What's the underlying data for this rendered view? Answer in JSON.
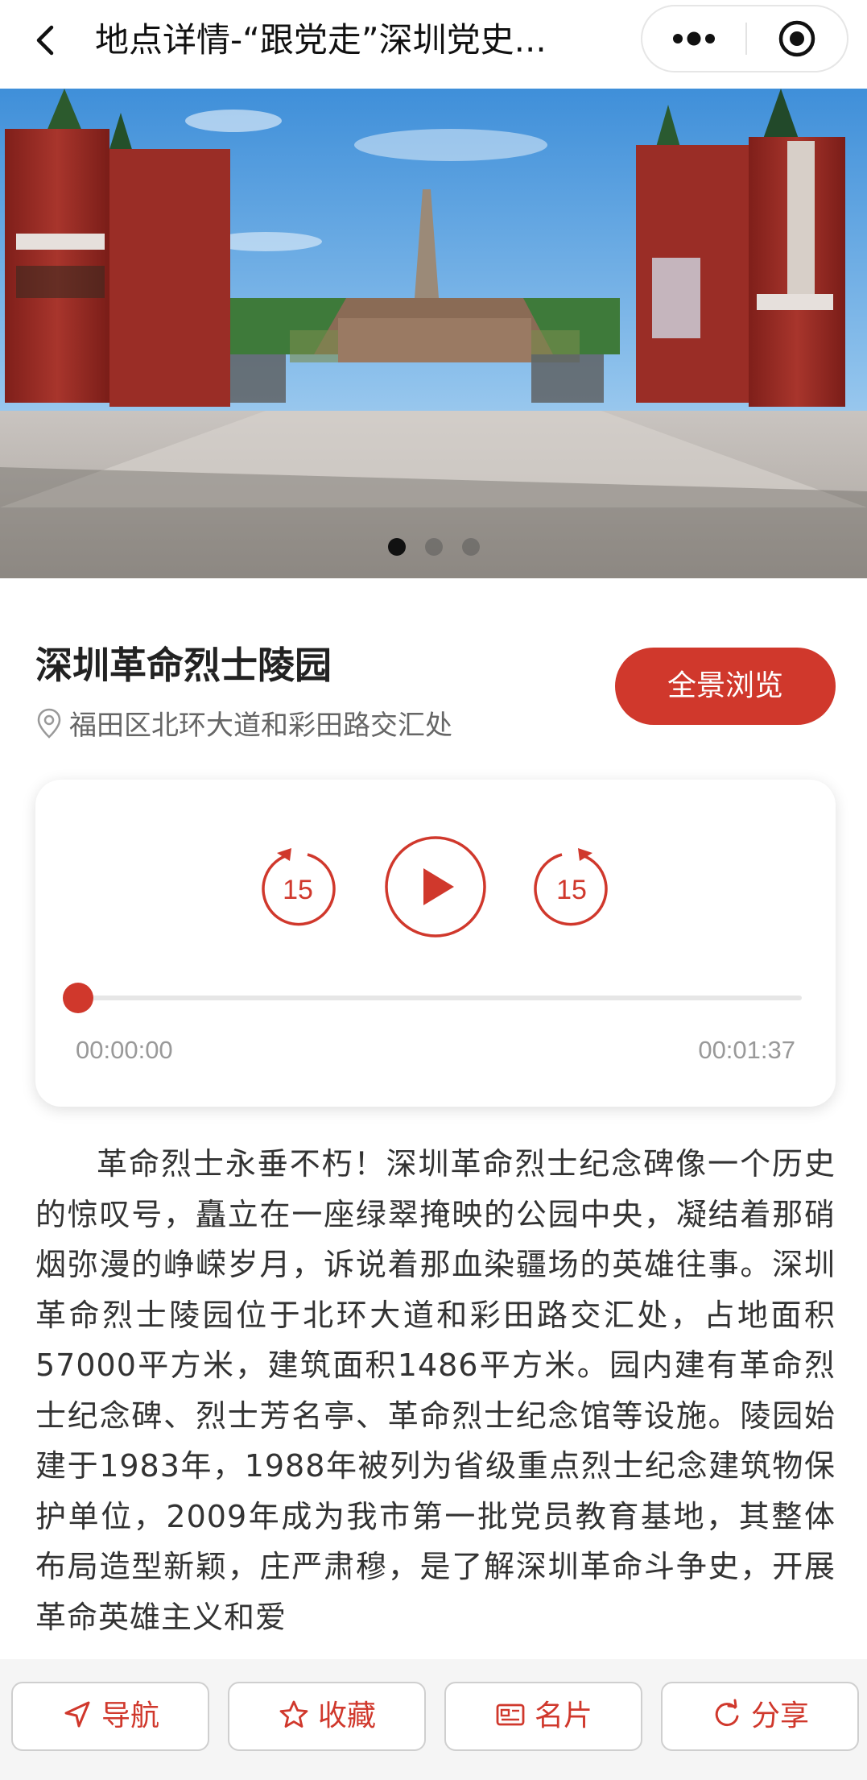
{
  "header": {
    "title": "地点详情-“跟党走”深圳党史...",
    "back_icon": "chevron-left-icon",
    "more_icon": "more-dots-icon",
    "close_icon": "target-circle-icon"
  },
  "carousel": {
    "slide_count": 3,
    "active_index": 0
  },
  "place": {
    "name": "深圳革命烈士陵园",
    "address": "福田区北环大道和彩田路交汇处",
    "panorama_button": "全景浏览"
  },
  "player": {
    "rewind_label": "15",
    "forward_label": "15",
    "current_time": "00:00:00",
    "total_time": "00:01:37",
    "progress": 0
  },
  "description": "革命烈士永垂不朽！深圳革命烈士纪念碑像一个历史的惊叹号，矗立在一座绿翠掩映的公园中央，凝结着那硝烟弥漫的峥嵘岁月，诉说着那血染疆场的英雄往事。深圳革命烈士陵园位于北环大道和彩田路交汇处，占地面积57000平方米，建筑面积1486平方米。园内建有革命烈士纪念碑、烈士芳名亭、革命烈士纪念馆等设施。陵园始建于1983年，1988年被列为省级重点烈士纪念建筑物保护单位，2009年成为我市第一批党员教育基地，其整体布局造型新颖，庄严肃穆，是了解深圳革命斗争史，开展革命英雄主义和爱",
  "actions": {
    "navigate": "导航",
    "favorite": "收藏",
    "card": "名片",
    "share": "分享"
  },
  "colors": {
    "accent": "#d0382c",
    "text_secondary": "#666666",
    "time_text": "#999999"
  }
}
